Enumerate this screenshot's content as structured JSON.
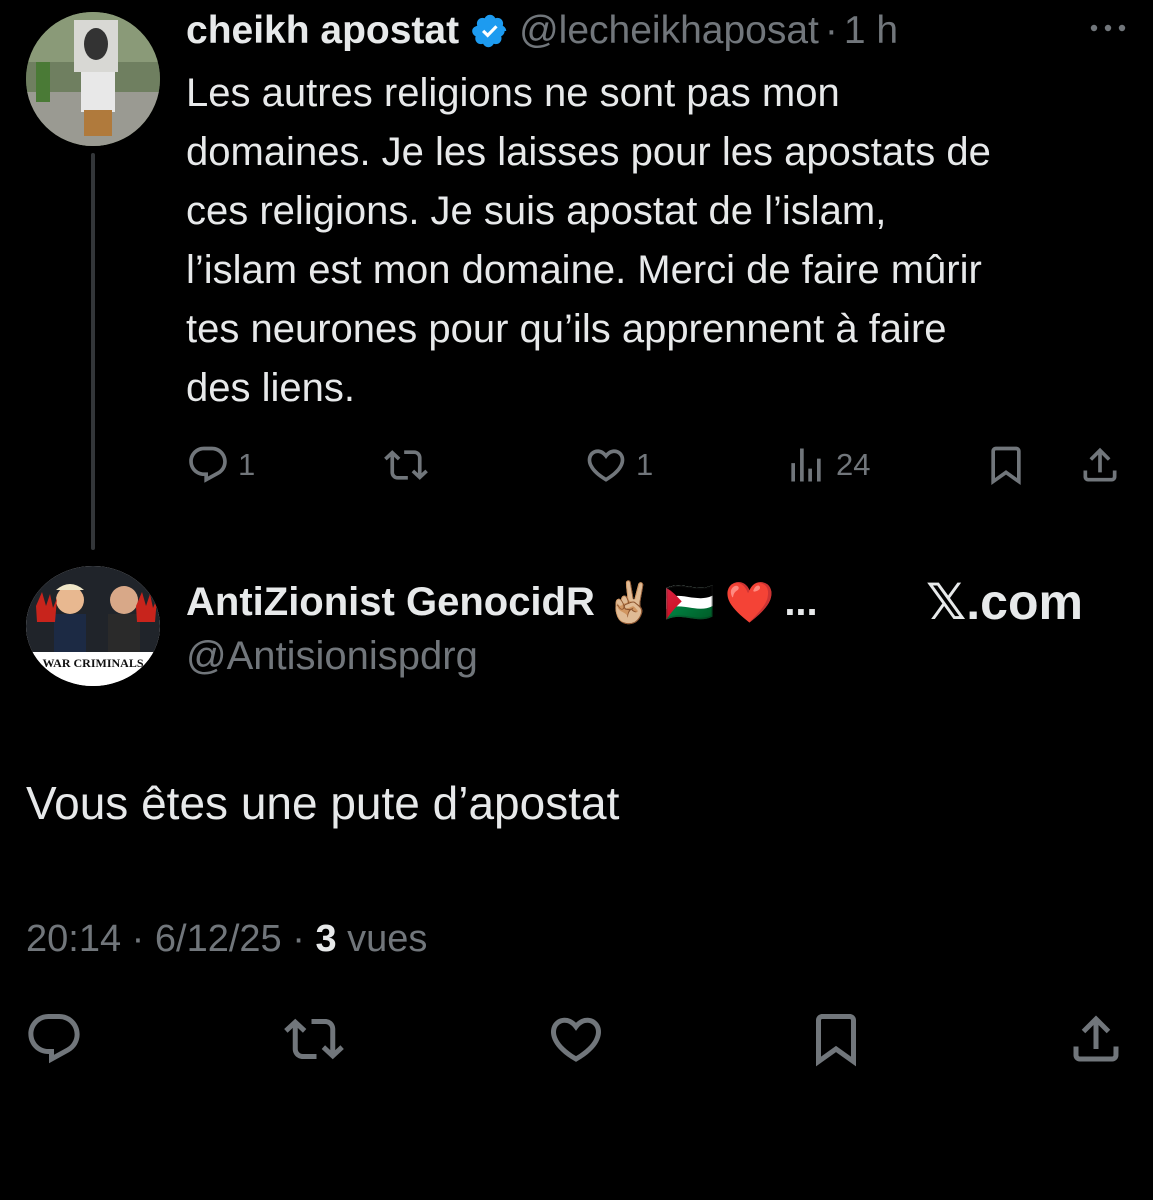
{
  "parent_tweet": {
    "display_name": "cheikh apostat",
    "handle": "@lecheikhaposat",
    "separator": "·",
    "time": "1 h",
    "text": "Les autres religions ne sont pas mon domaines. Je les laisses pour les apostats de ces religions. Je suis apostat de l’islam, l’islam est mon domaine. Merci de faire mûrir tes neurones pour qu’ils apprennent à faire des liens.",
    "lines": [
      "Les autres religions ne sont pas mon",
      "domaines. Je les laisses pour les apostats de",
      "ces religions. Je suis apostat de l’islam,",
      "l’islam est mon domaine. Merci de faire mûrir",
      "tes neurones pour qu’ils apprennent à faire",
      "des liens."
    ],
    "actions": {
      "reply_count": "1",
      "retweet_count": "",
      "like_count": "1",
      "views_count": "24"
    },
    "icons": [
      "reply-icon",
      "retweet-icon",
      "like-icon",
      "views-icon",
      "bookmark-icon",
      "share-icon",
      "more-icon",
      "verified-badge-icon"
    ]
  },
  "reply_tweet": {
    "display_name": "AntiZionist GenocidR",
    "name_emojis": [
      "✌🏼",
      "🇵🇸",
      "❤️"
    ],
    "name_ellipsis": "...",
    "handle": "@Antisionispdrg",
    "watermark": "𝕏.com",
    "avatar_caption": "WAR CRIMINALS",
    "text": "Vous êtes une pute d’apostat",
    "time": "20:14",
    "separator": "·",
    "date": "6/12/25",
    "views_count": "3",
    "views_label": "vues",
    "icons": [
      "reply-icon",
      "retweet-icon",
      "like-icon",
      "bookmark-icon",
      "share-icon"
    ]
  },
  "colors": {
    "background": "#000000",
    "text_primary": "#e7e9ea",
    "text_secondary": "#71767b",
    "verified_blue": "#1d9bf0",
    "thread_line": "#333639"
  }
}
